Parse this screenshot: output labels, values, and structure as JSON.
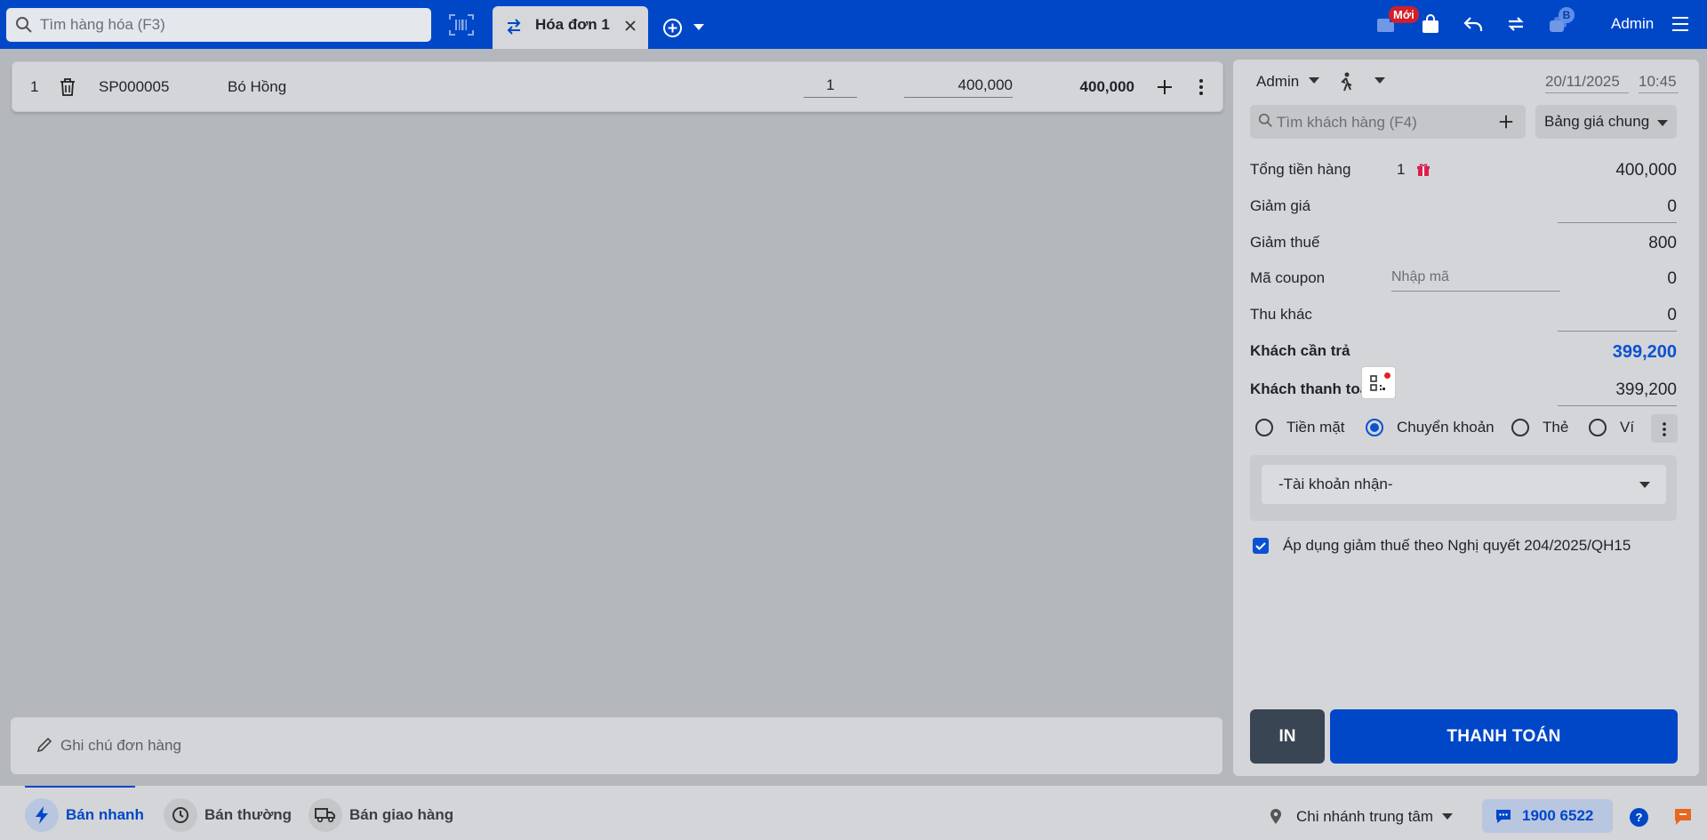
{
  "topbar": {
    "search_placeholder": "Tìm hàng hóa (F3)",
    "tab_label": "Hóa đơn 1",
    "new_badge": "Mới",
    "notif_badge": "B",
    "user": "Admin"
  },
  "cart": {
    "items": [
      {
        "index": "1",
        "code": "SP000005",
        "name": "Bó Hồng",
        "qty": "1",
        "price": "400,000",
        "total": "400,000"
      }
    ]
  },
  "note": {
    "placeholder": "Ghi chú đơn hàng"
  },
  "panel": {
    "seller": "Admin",
    "date": "20/11/2025",
    "time": "10:45",
    "customer_placeholder": "Tìm khách hàng (F4)",
    "price_book": "Bảng giá chung",
    "rows": {
      "subtotal_label": "Tổng tiền hàng",
      "subtotal_count": "1",
      "subtotal_value": "400,000",
      "discount_label": "Giảm giá",
      "discount_value": "0",
      "tax_discount_label": "Giảm thuế",
      "tax_discount_value": "800",
      "coupon_label": "Mã coupon",
      "coupon_placeholder": "Nhập mã",
      "coupon_value": "0",
      "other_label": "Thu khác",
      "other_value": "0",
      "due_label": "Khách cần trả",
      "due_value": "399,200",
      "paid_label": "Khách thanh toán",
      "paid_value": "399,200"
    },
    "payment_methods": [
      {
        "label": "Tiền mặt",
        "selected": false
      },
      {
        "label": "Chuyển khoản",
        "selected": true
      },
      {
        "label": "Thẻ",
        "selected": false
      },
      {
        "label": "Ví",
        "selected": false
      }
    ],
    "account_select": "-Tài khoản nhận-",
    "tax_checkbox_label": "Áp dụng giảm thuế theo Nghị quyết 204/2025/QH15",
    "tax_checkbox_checked": true,
    "print_label": "IN",
    "pay_label": "THANH TOÁN"
  },
  "bottombar": {
    "modes": [
      {
        "label": "Bán nhanh",
        "active": true
      },
      {
        "label": "Bán thường",
        "active": false
      },
      {
        "label": "Bán giao hàng",
        "active": false
      }
    ],
    "branch": "Chi nhánh trung tâm",
    "hotline": "1900 6522",
    "help": "?"
  },
  "colors": {
    "brand": "#0047c8",
    "accent_text": "#0a52d1",
    "badge_red": "#d21f2a",
    "print_btn": "#3a4553"
  }
}
